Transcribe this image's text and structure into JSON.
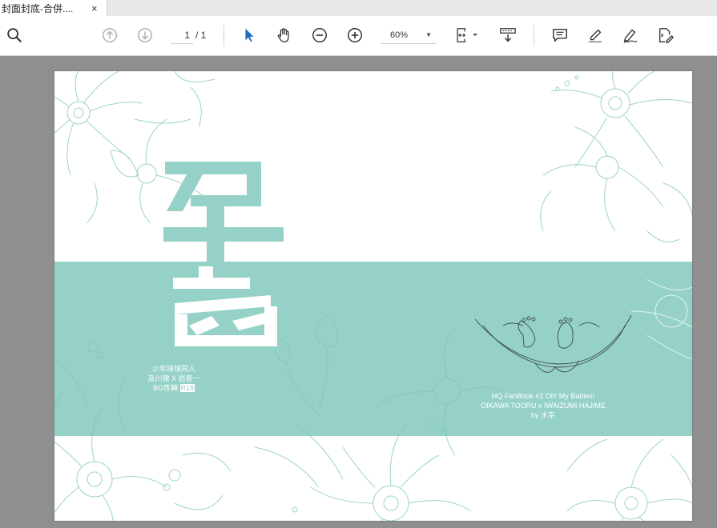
{
  "tab": {
    "title": "封面封底-合併....",
    "close_glyph": "×"
  },
  "toolbar": {
    "page_current": "1",
    "page_total": "/ 1",
    "zoom_value": "60%",
    "zoom_caret": "▼"
  },
  "icons": {
    "search": "search-icon",
    "prev_page": "arrow-up-circle-icon",
    "next_page": "arrow-down-circle-icon",
    "select": "pointer-icon",
    "hand": "hand-icon",
    "zoom_out": "zoom-out-icon",
    "zoom_in": "zoom-in-icon",
    "fit": "fit-page-icon",
    "scroll": "scroll-mode-icon",
    "comment": "comment-icon",
    "highlight": "highlight-icon",
    "sign": "sign-icon",
    "edit": "edit-pdf-icon"
  },
  "cover": {
    "left_lines": [
      "少年排球同人",
      "及川徹 X 岩泉一"
    ],
    "left_line3_prefix": "BG性轉 ",
    "left_line3_highlight": "R18",
    "right_lines": [
      "HQ FanBook #2  Oh! My Babies!",
      "OIKAWA TOORU x IWAIZUMI HAJIME",
      "by 水京"
    ]
  },
  "colors": {
    "band": "#95d1c7",
    "accent_blue": "#1f6fbf",
    "line_art": "#7cc4b8"
  }
}
